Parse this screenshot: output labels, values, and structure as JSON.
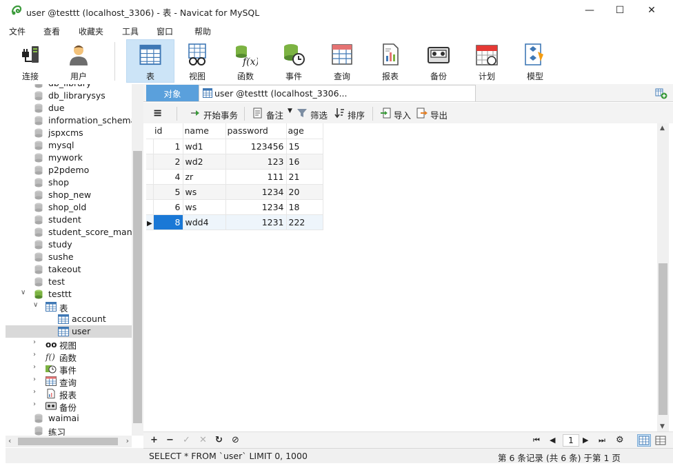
{
  "window": {
    "title": "user @testtt (localhost_3306) - 表 - Navicat for MySQL",
    "minimize": "—",
    "maximize": "☐",
    "close": "✕"
  },
  "menu": [
    "文件",
    "查看",
    "收藏夹",
    "工具",
    "窗口",
    "帮助"
  ],
  "toolbar": {
    "items": [
      "连接",
      "用户",
      "表",
      "视图",
      "函数",
      "事件",
      "查询",
      "报表",
      "备份",
      "计划",
      "模型"
    ],
    "active": "表"
  },
  "navigator": {
    "items": [
      {
        "label": "db_library",
        "type": "db"
      },
      {
        "label": "db_librarysys",
        "type": "db"
      },
      {
        "label": "due",
        "type": "db"
      },
      {
        "label": "information_schema",
        "type": "db"
      },
      {
        "label": "jspxcms",
        "type": "db"
      },
      {
        "label": "mysql",
        "type": "db"
      },
      {
        "label": "mywork",
        "type": "db"
      },
      {
        "label": "p2pdemo",
        "type": "db"
      },
      {
        "label": "shop",
        "type": "db"
      },
      {
        "label": "shop_new",
        "type": "db"
      },
      {
        "label": "shop_old",
        "type": "db"
      },
      {
        "label": "student",
        "type": "db"
      },
      {
        "label": "student_score_manag",
        "type": "db"
      },
      {
        "label": "study",
        "type": "db"
      },
      {
        "label": "sushe",
        "type": "db"
      },
      {
        "label": "takeout",
        "type": "db"
      },
      {
        "label": "test",
        "type": "db"
      },
      {
        "label": "testtt",
        "type": "db-open"
      },
      {
        "label": "表",
        "type": "group-open"
      },
      {
        "label": "account",
        "type": "table"
      },
      {
        "label": "user",
        "type": "table-selected"
      },
      {
        "label": "视图",
        "type": "group"
      },
      {
        "label": "函数",
        "type": "group"
      },
      {
        "label": "事件",
        "type": "group"
      },
      {
        "label": "查询",
        "type": "group"
      },
      {
        "label": "报表",
        "type": "group"
      },
      {
        "label": "备份",
        "type": "group"
      },
      {
        "label": "waimai",
        "type": "db"
      },
      {
        "label": "练习",
        "type": "db"
      }
    ]
  },
  "tabs": {
    "objects": "对象",
    "current": "user @testtt (localhost_3306..."
  },
  "datatools": {
    "menu_icon": "≡",
    "begin_tx": "开始事务",
    "note": "备注",
    "filter": "筛选",
    "sort": "排序",
    "import": "导入",
    "export": "导出"
  },
  "grid": {
    "columns": [
      "id",
      "name",
      "password",
      "age"
    ],
    "rows": [
      [
        "1",
        "wd1",
        "123456",
        "15"
      ],
      [
        "2",
        "wd2",
        "123",
        "16"
      ],
      [
        "4",
        "zr",
        "111",
        "21"
      ],
      [
        "5",
        "ws",
        "1234",
        "20"
      ],
      [
        "6",
        "ws",
        "1234",
        "18"
      ],
      [
        "8",
        "wdd4",
        "1231",
        "222"
      ]
    ],
    "current_row": 5
  },
  "gridnav": {
    "add": "+",
    "remove": "−",
    "apply": "✓",
    "cancel": "✕",
    "refresh": "↻",
    "stop": "⊘",
    "page": "1"
  },
  "status": {
    "sql": "SELECT * FROM `user` LIMIT 0, 1000",
    "records": "第 6 条记录 (共 6 条) 于第 1 页"
  },
  "colors": {
    "accent": "#1a78d6",
    "tab_active": "#5aa0dc",
    "toolbar_active": "#cce4f7"
  }
}
